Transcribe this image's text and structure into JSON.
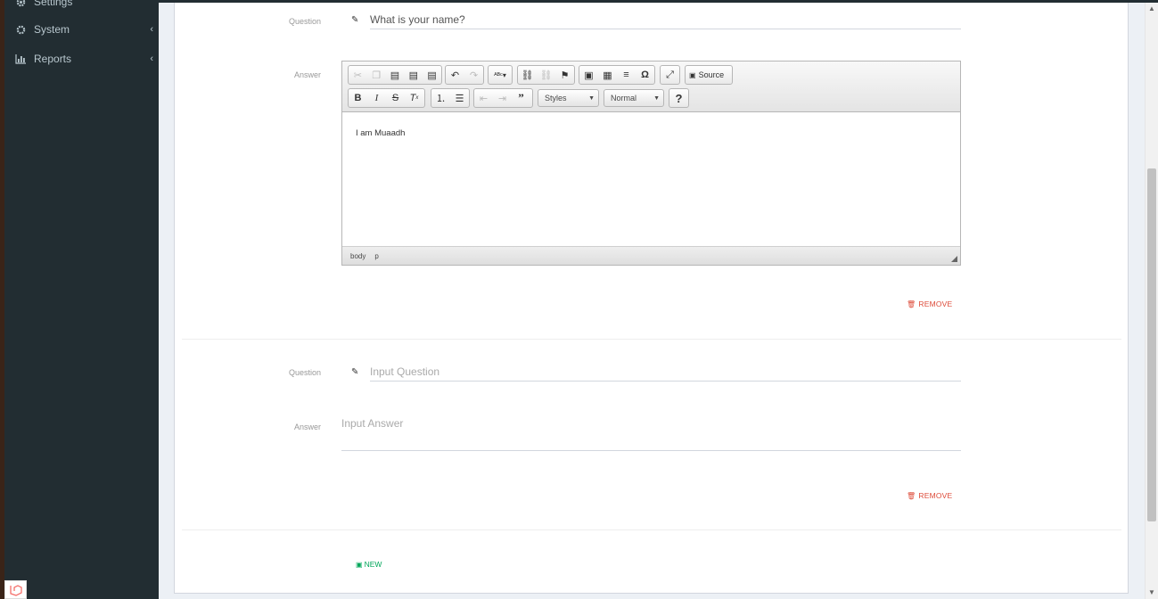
{
  "sidebar": {
    "items": [
      {
        "label": "Settings",
        "icon": "gear-icon"
      },
      {
        "label": "System",
        "icon": "gear-icon"
      },
      {
        "label": "Reports",
        "icon": "bar-chart-icon"
      }
    ]
  },
  "faq": [
    {
      "question_label": "Question",
      "question_value": "What is your name?",
      "answer_label": "Answer",
      "answer_html": "I am Muaadh",
      "remove_label": "REMOVE"
    },
    {
      "question_label": "Question",
      "question_placeholder": "Input Question",
      "answer_label": "Answer",
      "answer_placeholder": "Input Answer",
      "remove_label": "REMOVE"
    }
  ],
  "editor": {
    "source_label": "Source",
    "styles_label": "Styles",
    "format_label": "Normal",
    "status_path": [
      "body",
      "p"
    ]
  },
  "actions": {
    "new_label": "NEW"
  },
  "colors": {
    "sidebar_bg": "#222d32",
    "remove": "#dd4b39",
    "new": "#00a65a"
  }
}
